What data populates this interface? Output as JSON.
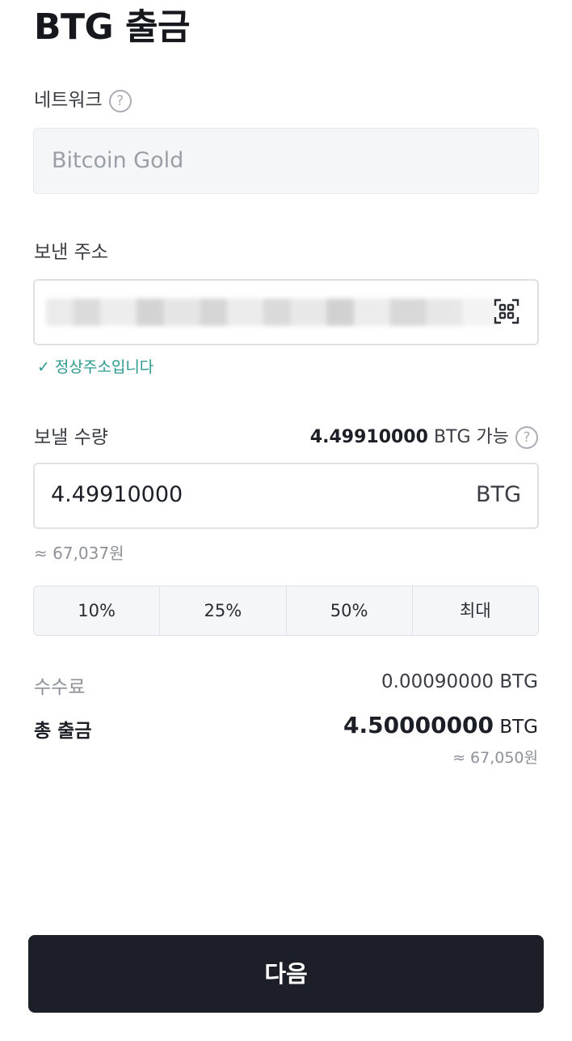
{
  "header": {
    "title": "BTG 출금"
  },
  "network": {
    "label": "네트워크",
    "help_icon": "?",
    "value": "Bitcoin Gold"
  },
  "address": {
    "label": "보낸 주소",
    "validation_message": "정상주소입니다",
    "check_icon": "✓"
  },
  "amount": {
    "label": "보낼 수량",
    "available_amount": "4.49910000",
    "available_suffix": "BTG 가능",
    "help_icon": "?",
    "value": "4.49910000",
    "unit": "BTG",
    "krw_approx": "≈ 67,037원"
  },
  "percent_buttons": [
    "10%",
    "25%",
    "50%",
    "최대"
  ],
  "summary": {
    "fee_label": "수수료",
    "fee_amount": "0.00090000",
    "fee_unit": "BTG",
    "total_label": "총 출금",
    "total_amount": "4.50000000",
    "total_unit": "BTG",
    "total_krw": "≈ 67,050원"
  },
  "footer": {
    "next_label": "다음"
  },
  "colors": {
    "accent_valid": "#2b9a8e",
    "button_dark": "#1c1f28"
  }
}
